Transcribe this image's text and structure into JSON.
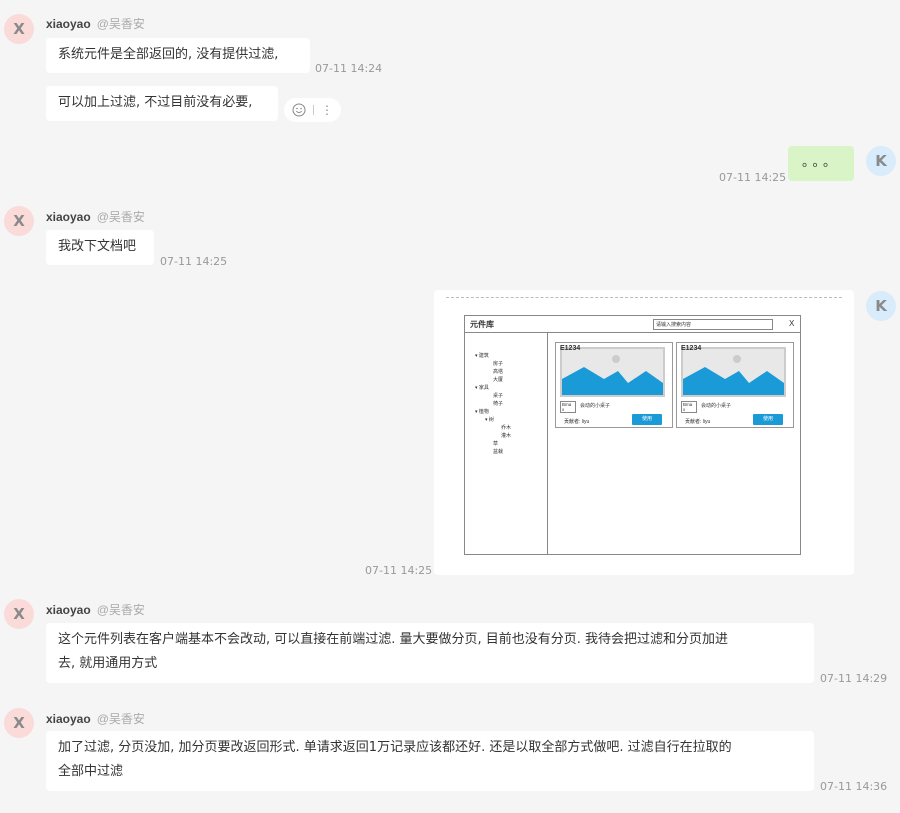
{
  "messages": [
    {
      "author": "xiaoyao",
      "handle": "@吴香安",
      "avatar": "X",
      "text": "系统元件是全部返回的, 没有提供过滤,",
      "time": "07-11 14:24"
    },
    {
      "text": "可以加上过滤, 不过目前没有必要,"
    },
    {
      "avatar": "K",
      "text": "。。。",
      "time": "07-11 14:25"
    },
    {
      "author": "xiaoyao",
      "handle": "@吴香安",
      "avatar": "X",
      "text": "我改下文档吧",
      "time": "07-11 14:25"
    },
    {
      "avatar": "K",
      "time": "07-11 14:25"
    },
    {
      "author": "xiaoyao",
      "handle": "@吴香安",
      "avatar": "X",
      "text_line1": "这个元件列表在客户端基本不会改动, 可以直接在前端过滤.   量大要做分页, 目前也没有分页.  我待会把过滤和分页加进",
      "text_line2": "去, 就用通用方式",
      "time": "07-11 14:29"
    },
    {
      "author": "xiaoyao",
      "handle": "@吴香安",
      "avatar": "X",
      "text_line1": "加了过滤, 分页没加, 加分页要改返回形式.  单请求返回1万记录应该都还好.   还是以取全部方式做吧.   过滤自行在拉取的",
      "text_line2": "全部中过滤",
      "time": "07-11 14:36"
    }
  ],
  "actions": {
    "emoji_icon": "smile-icon",
    "more_icon": "more-vertical-icon",
    "more_glyph": "⋮"
  },
  "wireframe": {
    "title": "元件库",
    "search_placeholder": "请输入搜索内容",
    "close": "X",
    "tree": [
      "▾ 建筑",
      "房子",
      "高塔",
      "大厦",
      "▾ 家具",
      "桌子",
      "椅子",
      "▾ 植物",
      "▾ 树",
      "乔木",
      "灌木",
      "草",
      "盆栽"
    ],
    "cards": [
      {
        "id": "E1234",
        "tag": "Bma x",
        "name": "会动的小桌子",
        "contributor": "贡献者: liyu",
        "button": "使用"
      },
      {
        "id": "E1234",
        "tag": "Bma x",
        "name": "会动的小桌子",
        "contributor": "贡献者: liyu",
        "button": "使用"
      }
    ],
    "accent": "#1a9bd7"
  }
}
